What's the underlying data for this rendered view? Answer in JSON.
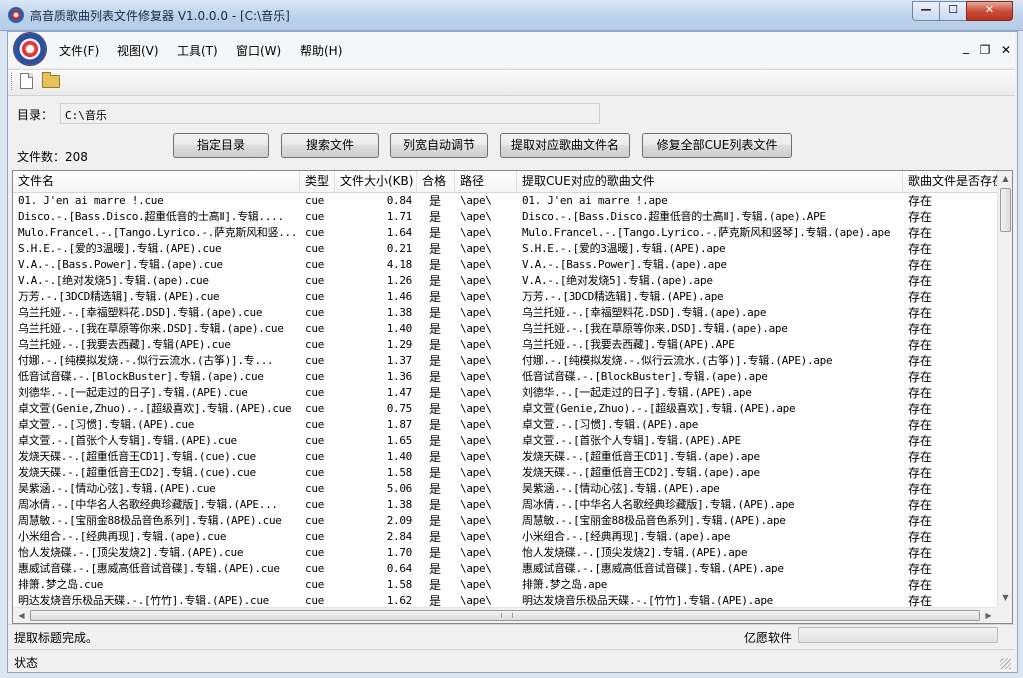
{
  "window": {
    "title": "高音质歌曲列表文件修复器 V1.0.0.0 - [C:\\音乐]",
    "min_glyph": "—",
    "max_glyph": "☐",
    "close_glyph": "✕"
  },
  "menu": {
    "items": [
      "文件(F)",
      "视图(V)",
      "工具(T)",
      "窗口(W)",
      "帮助(H)"
    ],
    "mdi_min": "_",
    "mdi_restore": "❐",
    "mdi_close": "✕"
  },
  "toolbar": {
    "icons": [
      "new-file-icon",
      "open-folder-icon"
    ]
  },
  "form": {
    "dir_label": "目录：",
    "dir_value": "C:\\音乐",
    "count_label": "文件数：208",
    "buttons": [
      "指定目录",
      "搜索文件",
      "列宽自动调节",
      "提取对应歌曲文件名",
      "修复全部CUE列表文件"
    ]
  },
  "table": {
    "headers": [
      "文件名",
      "类型",
      "文件大小(KB)",
      "合格",
      "路径",
      "提取CUE对应的歌曲文件",
      "歌曲文件是否存在"
    ],
    "rows": [
      [
        "01. J'en ai marre !.cue",
        "cue",
        "0.84",
        "是",
        "\\ape\\",
        "01. J'en ai marre !.ape",
        "存在"
      ],
      [
        "Disco.-.[Bass.Disco.超重低音的士高Ⅱ].专辑....",
        "cue",
        "1.71",
        "是",
        "\\ape\\",
        "Disco.-.[Bass.Disco.超重低音的士高Ⅱ].专辑.(ape).APE",
        "存在"
      ],
      [
        "Mulo.Francel.-.[Tango.Lyrico.-.萨克斯风和竖...",
        "cue",
        "1.64",
        "是",
        "\\ape\\",
        "Mulo.Francel.-.[Tango.Lyrico.-.萨克斯风和竖琴].专辑.(ape).ape",
        "存在"
      ],
      [
        "S.H.E.-.[爱的3温暖].专辑.(APE).cue",
        "cue",
        "0.21",
        "是",
        "\\ape\\",
        "S.H.E.-.[爱的3温暖].专辑.(APE).ape",
        "存在"
      ],
      [
        "V.A.-.[Bass.Power].专辑.(ape).cue",
        "cue",
        "4.18",
        "是",
        "\\ape\\",
        "V.A.-.[Bass.Power].专辑.(ape).ape",
        "存在"
      ],
      [
        "V.A.-.[绝对发烧5].专辑.(ape).cue",
        "cue",
        "1.26",
        "是",
        "\\ape\\",
        "V.A.-.[绝对发烧5].专辑.(ape).ape",
        "存在"
      ],
      [
        "万芳.-.[3DCD精选辑].专辑.(APE).cue",
        "cue",
        "1.46",
        "是",
        "\\ape\\",
        "万芳.-.[3DCD精选辑].专辑.(APE).ape",
        "存在"
      ],
      [
        "乌兰托娅.-.[幸福塑料花.DSD].专辑.(ape).cue",
        "cue",
        "1.38",
        "是",
        "\\ape\\",
        "乌兰托娅.-.[幸福塑料花.DSD].专辑.(ape).ape",
        "存在"
      ],
      [
        "乌兰托娅.-.[我在草原等你来.DSD].专辑.(ape).cue",
        "cue",
        "1.40",
        "是",
        "\\ape\\",
        "乌兰托娅.-.[我在草原等你来.DSD].专辑.(ape).ape",
        "存在"
      ],
      [
        "乌兰托娅.-.[我要去西藏].专辑(APE).cue",
        "cue",
        "1.29",
        "是",
        "\\ape\\",
        "乌兰托娅.-.[我要去西藏].专辑(APE).APE",
        "存在"
      ],
      [
        "付娜.-.[纯模拟发烧.-.似行云流水.(古筝)].专...",
        "cue",
        "1.37",
        "是",
        "\\ape\\",
        "付娜.-.[纯模拟发烧.-.似行云流水.(古筝)].专辑.(APE).ape",
        "存在"
      ],
      [
        "低音试音碟.-.[BlockBuster].专辑.(ape).cue",
        "cue",
        "1.36",
        "是",
        "\\ape\\",
        "低音试音碟.-.[BlockBuster].专辑.(ape).ape",
        "存在"
      ],
      [
        "刘德华.-.[一起走过的日子].专辑.(APE).cue",
        "cue",
        "1.47",
        "是",
        "\\ape\\",
        "刘德华.-.[一起走过的日子].专辑.(APE).ape",
        "存在"
      ],
      [
        "卓文萱(Genie,Zhuo).-.[超级喜欢].专辑.(APE).cue",
        "cue",
        "0.75",
        "是",
        "\\ape\\",
        "卓文萱(Genie,Zhuo).-.[超级喜欢].专辑.(APE).ape",
        "存在"
      ],
      [
        "卓文萱.-.[习惯].专辑.(APE).cue",
        "cue",
        "1.87",
        "是",
        "\\ape\\",
        "卓文萱.-.[习惯].专辑.(APE).ape",
        "存在"
      ],
      [
        "卓文萱.-.[首张个人专辑].专辑.(APE).cue",
        "cue",
        "1.65",
        "是",
        "\\ape\\",
        "卓文萱.-.[首张个人专辑].专辑.(APE).APE",
        "存在"
      ],
      [
        "发烧天碟.-.[超重低音王CD1].专辑.(cue).cue",
        "cue",
        "1.40",
        "是",
        "\\ape\\",
        "发烧天碟.-.[超重低音王CD1].专辑.(ape).ape",
        "存在"
      ],
      [
        "发烧天碟.-.[超重低音王CD2].专辑.(cue).cue",
        "cue",
        "1.58",
        "是",
        "\\ape\\",
        "发烧天碟.-.[超重低音王CD2].专辑.(ape).ape",
        "存在"
      ],
      [
        "吴紫涵.-.[情动心弦].专辑.(APE).cue",
        "cue",
        "5.06",
        "是",
        "\\ape\\",
        "吴紫涵.-.[情动心弦].专辑.(APE).ape",
        "存在"
      ],
      [
        "周冰倩.-.[中华名人名歌经典珍藏版].专辑.(APE...",
        "cue",
        "1.38",
        "是",
        "\\ape\\",
        "周冰倩.-.[中华名人名歌经典珍藏版].专辑.(APE).ape",
        "存在"
      ],
      [
        "周慧敏.-.[宝丽金88极品音色系列].专辑.(APE).cue",
        "cue",
        "2.09",
        "是",
        "\\ape\\",
        "周慧敏.-.[宝丽金88极品音色系列].专辑.(APE).ape",
        "存在"
      ],
      [
        "小米组合.-.[经典再现].专辑.(ape).cue",
        "cue",
        "2.84",
        "是",
        "\\ape\\",
        "小米组合.-.[经典再现].专辑.(ape).ape",
        "存在"
      ],
      [
        "怡人发烧碟.-.[顶尖发烧2].专辑.(APE).cue",
        "cue",
        "1.70",
        "是",
        "\\ape\\",
        "怡人发烧碟.-.[顶尖发烧2].专辑.(APE).ape",
        "存在"
      ],
      [
        "惠威试音碟.-.[惠威高低音试音碟].专辑.(APE).cue",
        "cue",
        "0.64",
        "是",
        "\\ape\\",
        "惠威试音碟.-.[惠威高低音试音碟].专辑.(APE).ape",
        "存在"
      ],
      [
        "排箫.梦之岛.cue",
        "cue",
        "1.58",
        "是",
        "\\ape\\",
        "排箫.梦之岛.ape",
        "存在"
      ],
      [
        "明达发烧音乐极品天碟.-.[竹竹].专辑.(APE).cue",
        "cue",
        "1.62",
        "是",
        "\\ape\\",
        "明达发烧音乐极品天碟.-.[竹竹].专辑.(APE).ape",
        "存在"
      ]
    ]
  },
  "statusbar": {
    "message": "提取标题完成。",
    "company": "亿愿软件",
    "progress": 0,
    "status_label": "状态"
  },
  "colors": {
    "title_bar": "#bcd0ea",
    "close_button": "#c8503a",
    "window_bg": "#f0f0f0"
  }
}
